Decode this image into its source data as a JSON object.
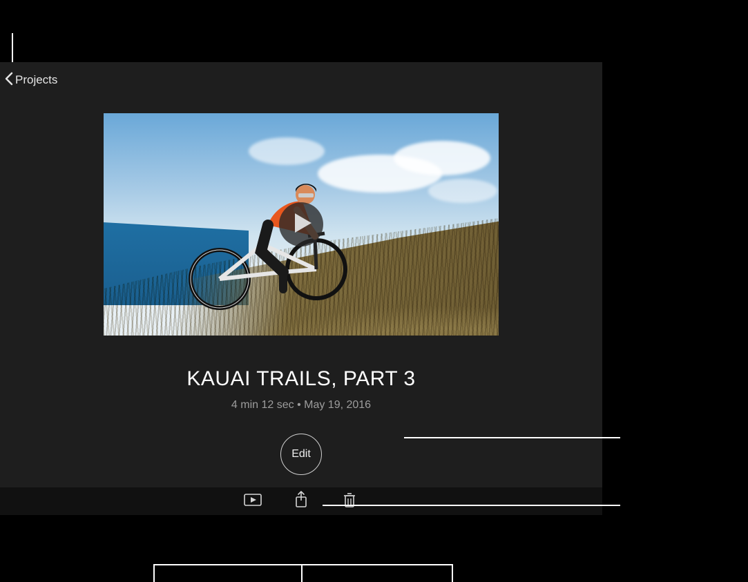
{
  "nav": {
    "back_label": "Projects"
  },
  "project": {
    "title": "KAUAI TRAILS, PART 3",
    "meta": "4 min 12 sec • May 19, 2016",
    "edit_label": "Edit"
  },
  "toolbar": {
    "play_label": "Play",
    "share_label": "Share",
    "delete_label": "Delete"
  },
  "icons": {
    "back": "chevron-left-icon",
    "play_overlay": "play-icon",
    "play": "play-rect-icon",
    "share": "share-icon",
    "trash": "trash-icon"
  }
}
